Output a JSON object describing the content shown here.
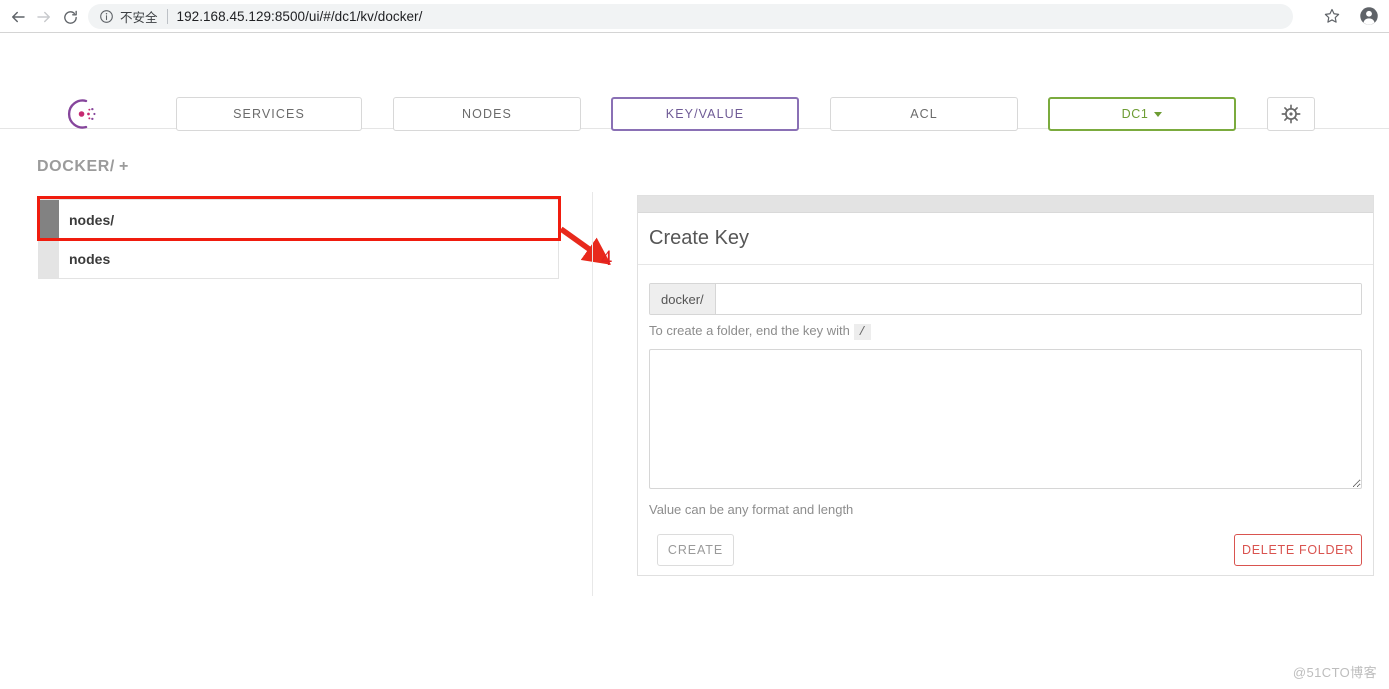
{
  "browser": {
    "back_icon": "arrow-left-icon",
    "forward_icon": "arrow-right-icon",
    "reload_icon": "reload-icon",
    "security_icon": "info-circle-icon",
    "security_label": "不安全",
    "url": "192.168.45.129:8500/ui/#/dc1/kv/docker/",
    "bookmark_icon": "star-icon",
    "profile_icon": "profile-avatar-icon"
  },
  "nav": {
    "logo": "consul-logo",
    "tabs": [
      {
        "label": "SERVICES",
        "active": false
      },
      {
        "label": "NODES",
        "active": false
      },
      {
        "label": "KEY/VALUE",
        "active": true
      },
      {
        "label": "ACL",
        "active": false
      }
    ],
    "datacenter": {
      "label": "DC1",
      "caret": "chevron-down-icon"
    },
    "settings_icon": "gear-icon"
  },
  "breadcrumb": {
    "path": "DOCKER/",
    "add": "+"
  },
  "key_list": [
    {
      "label": "nodes/",
      "state": "hovered"
    },
    {
      "label": "nodes",
      "state": "normal"
    }
  ],
  "annotation": {
    "number": "4",
    "color": "#e02020"
  },
  "panel": {
    "title": "Create Key",
    "key_prefix": "docker/",
    "key_value": "",
    "key_placeholder": "",
    "key_helper_before": "To create a folder, end the key with",
    "key_helper_code": "/",
    "value_text": "",
    "value_placeholder": "",
    "value_helper": "Value can be any format and length",
    "create_label": "CREATE",
    "delete_label": "DELETE FOLDER"
  },
  "watermark": "@51CTO博客",
  "colors": {
    "accent_purple": "#8a70b5",
    "accent_green": "#7bab3e",
    "danger_red": "#d9534f",
    "annotation_red": "#f01c0e"
  }
}
